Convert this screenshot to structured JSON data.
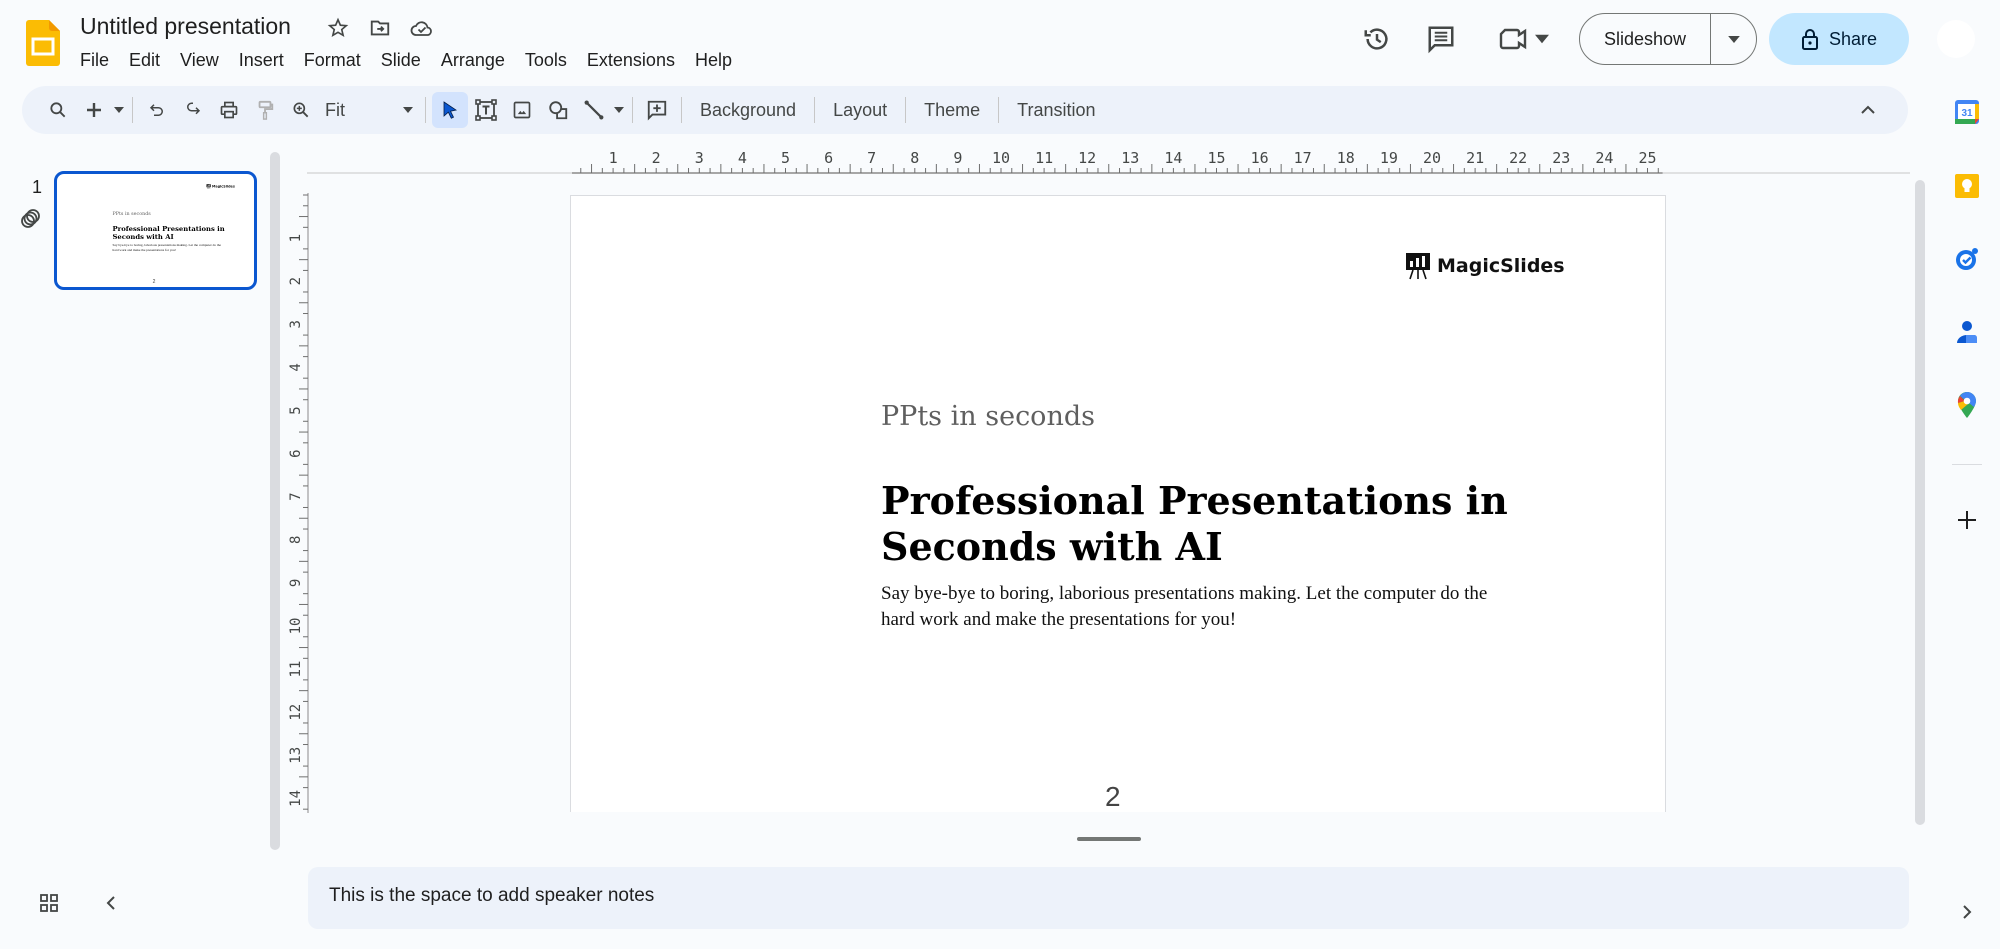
{
  "header": {
    "app_icon": "google-slides-logo",
    "title": "Untitled presentation",
    "title_icons": [
      "star-icon",
      "move-to-folder-icon",
      "cloud-saved-icon"
    ],
    "menu": [
      "File",
      "Edit",
      "View",
      "Insert",
      "Format",
      "Slide",
      "Arrange",
      "Tools",
      "Extensions",
      "Help"
    ],
    "right_icons": [
      "version-history-icon",
      "comments-icon",
      "meet-icon"
    ],
    "slideshow_label": "Slideshow",
    "share_label": "Share"
  },
  "toolbar": {
    "zoom_value": "Fit",
    "buttons": [
      "Background",
      "Layout",
      "Theme",
      "Transition"
    ]
  },
  "filmstrip": {
    "slides": [
      {
        "number": "1",
        "selected": true
      }
    ]
  },
  "rulers": {
    "horizontal": [
      "1",
      "2",
      "3",
      "4",
      "5",
      "6",
      "7",
      "8",
      "9",
      "10",
      "11",
      "12",
      "13",
      "14",
      "15",
      "16",
      "17",
      "18",
      "19",
      "20",
      "21",
      "22",
      "23",
      "24",
      "25"
    ],
    "vertical": [
      "1",
      "2",
      "3",
      "4",
      "5",
      "6",
      "7",
      "8",
      "9",
      "10",
      "11",
      "12",
      "13",
      "14"
    ]
  },
  "slide": {
    "logo_text": "MagicSlides",
    "subtitle": "PPts in seconds",
    "title": "Professional Presentations in Seconds with AI",
    "body": "Say bye-bye to boring, laborious presentations making. Let the computer do the hard work and make the presentations for you!",
    "page_number": "2"
  },
  "notes": {
    "placeholder": "This is the space to add speaker notes"
  },
  "side_panel": [
    "calendar-icon",
    "keep-icon",
    "tasks-icon",
    "contacts-icon",
    "maps-icon"
  ],
  "colors": {
    "accent": "#0b57d0",
    "share_bg": "#c2e7ff",
    "toolbar_bg": "#edf2fa",
    "selected_tool_bg": "#d3e3fd",
    "app_yellow": "#fbbc04"
  }
}
